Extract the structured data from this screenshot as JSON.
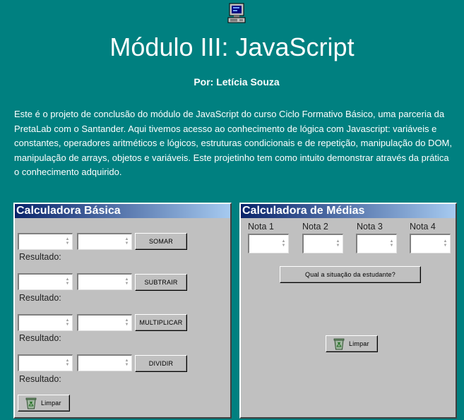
{
  "header": {
    "icon": "computer-icon",
    "title": "Módulo III: JavaScript",
    "author": "Por: Letícia Souza",
    "intro": "Este é o projeto de conclusão do módulo de JavaScript do curso Ciclo Formativo Básico, uma parceria da PretaLab com o Santander. Aqui tivemos acesso ao conhecimento de lógica com Javascript: variáveis e constantes, operadores aritméticos e lógicos, estruturas condicionais e de repetição, manipulação do DOM, manipulação de arrays, objetos e variáveis. Este projetinho tem como intuito demonstrar através da prática o conhecimento adquirido."
  },
  "basic_calc": {
    "title": "Calculadora Básica",
    "result_label": "Resultado:",
    "operations": [
      {
        "label": "SOMAR"
      },
      {
        "label": "SUBTRAIR"
      },
      {
        "label": "MULTIPLICAR"
      },
      {
        "label": "DIVIDIR"
      }
    ],
    "clear_label": "Limpar"
  },
  "avg_calc": {
    "title": "Calculadora de Médias",
    "notes": [
      "Nota 1",
      "Nota 2",
      "Nota 3",
      "Nota 4"
    ],
    "check_label": "Qual a situação da estudante?",
    "clear_label": "Limpar"
  },
  "colors": {
    "background": "#008080",
    "window": "#c0c0c0",
    "titlebar_start": "#0a246a",
    "titlebar_end": "#a6caf0"
  }
}
